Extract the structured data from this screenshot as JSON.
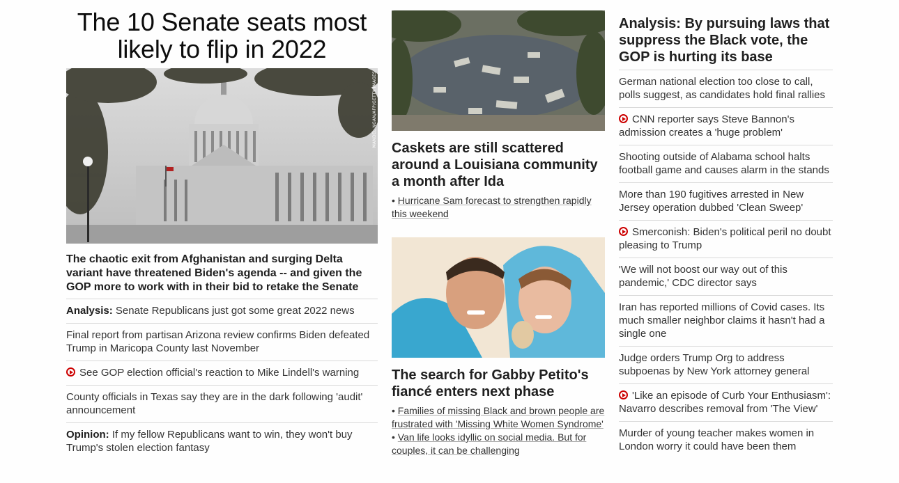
{
  "col1": {
    "headline": "The 10 Senate seats most likely to flip in 2022",
    "photo_credit": "MANDEL NGAN/AFP/GETTY IMAGES",
    "caption": "The chaotic exit from Afghanistan and surging Delta variant have threatened Biden's agenda -- and given the GOP more to work with in their bid to retake the Senate",
    "items": [
      {
        "prefix": "Analysis:",
        "text": "Senate Republicans just got some great 2022 news"
      },
      {
        "text": "Final report from partisan Arizona review confirms Biden defeated Trump in Maricopa County last November"
      },
      {
        "video": true,
        "text": "See GOP election official's reaction to Mike Lindell's warning"
      },
      {
        "text": "County officials in Texas say they are in the dark following 'audit' announcement"
      },
      {
        "prefix": "Opinion:",
        "text": "If my fellow Republicans want to win, they won't buy Trump's stolen election fantasy"
      }
    ]
  },
  "col2": {
    "story1": {
      "headline": "Caskets are still scattered around a Louisiana community a month after Ida",
      "bullets": [
        "Hurricane Sam forecast to strengthen rapidly this weekend"
      ]
    },
    "story2": {
      "headline": "The search for Gabby Petito's fiancé enters next phase",
      "bullets": [
        "Families of missing Black and brown people are frustrated with 'Missing White Women Syndrome'",
        "Van life looks idyllic on social media. But for couples, it can be challenging"
      ]
    }
  },
  "col3": {
    "headline": "Analysis: By pursuing laws that suppress the Black vote, the GOP is hurting its base",
    "items": [
      {
        "text": "German national election too close to call, polls suggest, as candidates hold final rallies"
      },
      {
        "video": true,
        "text": "CNN reporter says Steve Bannon's admission creates a 'huge problem'"
      },
      {
        "text": "Shooting outside of Alabama school halts football game and causes alarm in the stands"
      },
      {
        "text": "More than 190 fugitives arrested in New Jersey operation dubbed 'Clean Sweep'"
      },
      {
        "video": true,
        "text": "Smerconish: Biden's political peril no doubt pleasing to Trump"
      },
      {
        "text": "'We will not boost our way out of this pandemic,' CDC director says"
      },
      {
        "text": "Iran has reported millions of Covid cases. Its much smaller neighbor claims it hasn't had a single one"
      },
      {
        "text": "Judge orders Trump Org to address subpoenas by New York attorney general"
      },
      {
        "video": true,
        "text": "'Like an episode of Curb Your Enthusiasm': Navarro describes removal from 'The View'"
      },
      {
        "text": "Murder of young teacher makes women in London worry it could have been them"
      }
    ]
  },
  "colors": {
    "video_icon": "#cc0000",
    "divider": "#d9d9d9"
  }
}
